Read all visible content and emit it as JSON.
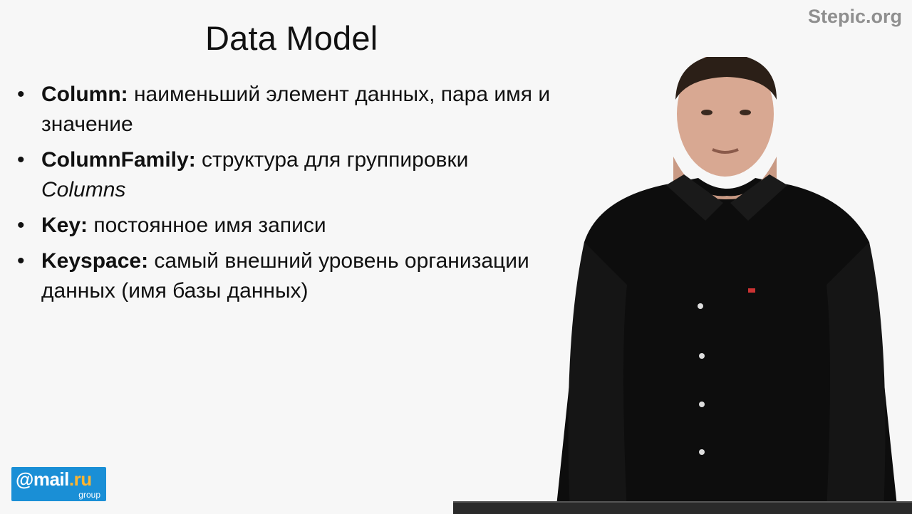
{
  "watermark": "Stepic.org",
  "title": "Data Model",
  "bullets": [
    {
      "term": "Column:",
      "text": " наименьший элемент данных, пара имя и значение",
      "extra": ""
    },
    {
      "term": "ColumnFamily:",
      "text": "  структура для группировки ",
      "extra": "Columns"
    },
    {
      "term": "Key:",
      "text": " постоянное имя записи",
      "extra": ""
    },
    {
      "term": "Keyspace:",
      "text": " самый внешний уровень организации данных (имя базы данных)",
      "extra": ""
    }
  ],
  "logo": {
    "brand": "@mail",
    "ru": ".ru",
    "sub": "group"
  },
  "colors": {
    "background": "#f7f7f7",
    "logo_blue": "#1a8fd6",
    "logo_accent": "#ffb52e",
    "watermark": "#8f8f8f"
  }
}
